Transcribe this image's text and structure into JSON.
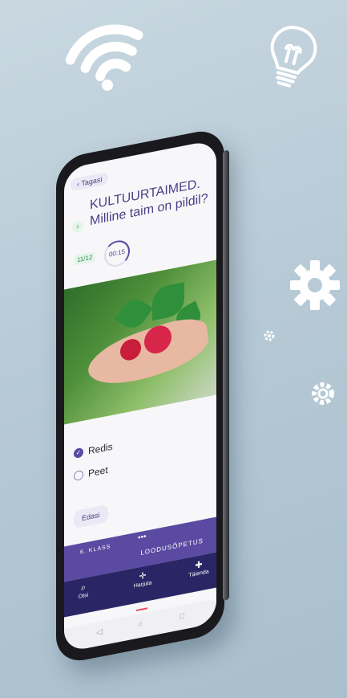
{
  "decor": {
    "wifi_icon": "wifi-icon",
    "bulb_icon": "lightbulb-icon",
    "gear_icon": "gear-icon"
  },
  "app": {
    "back_label": "Tagasi",
    "question": "KULTUURTAIMED. Milline taim on pildil?",
    "counter": "11/12",
    "timer": "00:15",
    "options": [
      {
        "label": "Redis",
        "selected": true
      },
      {
        "label": "Peet",
        "selected": false
      }
    ],
    "next_label": "Edasi",
    "grade": "6. KLASS",
    "subject": "LOODUSÕPETUS",
    "nav": [
      {
        "label": "Otsi",
        "icon": "search-icon"
      },
      {
        "label": "Harjuta",
        "icon": "target-icon"
      },
      {
        "label": "Täienda",
        "icon": "plus-icon"
      }
    ]
  },
  "colors": {
    "accent": "#5a4aa1",
    "nav_bg": "#2a2666",
    "active": "#e64a5c"
  }
}
